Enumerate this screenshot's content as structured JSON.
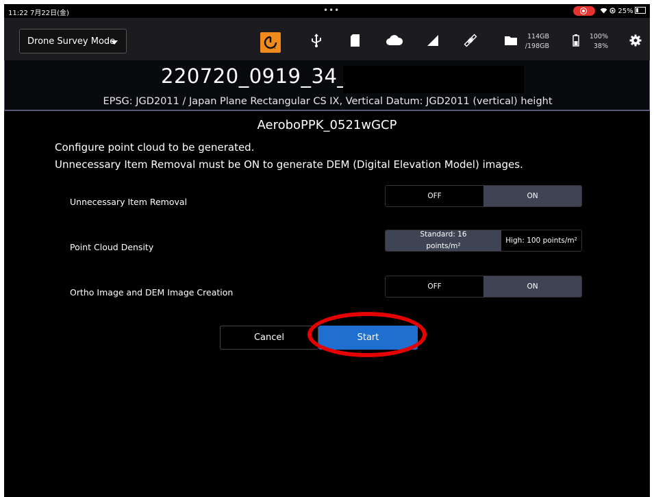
{
  "status_bar": {
    "time": "11:22 7月22日(金)",
    "dots": "•••",
    "battery_text": "25%"
  },
  "toolbar": {
    "mode_label": "Drone Survey Mode",
    "storage_used": "114GB",
    "storage_total": "/198GB",
    "battery_top": "100%",
    "battery_bottom": "38%",
    "accent_color": "#f08a1c"
  },
  "project": {
    "name": "220720_0919_34_",
    "epsg": "EPSG: JGD2011 / Japan Plane Rectangular CS IX, Vertical Datum: JGD2011 (vertical) height"
  },
  "dataset_name": "AeroboPPK_0521wGCP",
  "description": {
    "line1": "Configure point cloud to be generated.",
    "line2": "Unnecessary Item Removal must be ON to generate DEM (Digital Elevation Model) images."
  },
  "settings": [
    {
      "label": "Unnecessary Item Removal",
      "option_a": "OFF",
      "option_b": "ON",
      "selected": "ON"
    },
    {
      "label": "Point Cloud Density",
      "option_a": "Standard: 16 points/m²",
      "option_b": "High: 100 points/m²",
      "selected": "Standard: 16 points/m²"
    },
    {
      "label": "Ortho Image and DEM Image Creation",
      "option_a": "OFF",
      "option_b": "ON",
      "selected": "ON"
    }
  ],
  "buttons": {
    "cancel": "Cancel",
    "start": "Start",
    "start_color": "#1e6fd0"
  }
}
